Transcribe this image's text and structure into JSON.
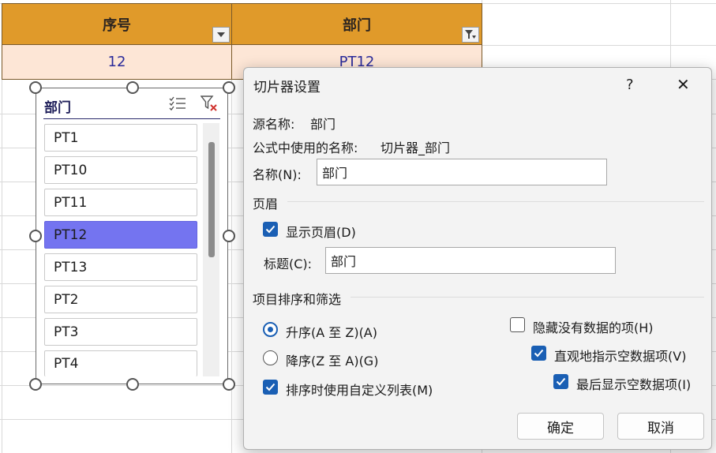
{
  "table": {
    "headers": [
      "序号",
      "部门"
    ],
    "row": [
      "12",
      "PT12"
    ]
  },
  "slicer": {
    "title": "部门",
    "items": [
      {
        "label": "PT1",
        "selected": false
      },
      {
        "label": "PT10",
        "selected": false
      },
      {
        "label": "PT11",
        "selected": false
      },
      {
        "label": "PT12",
        "selected": true
      },
      {
        "label": "PT13",
        "selected": false
      },
      {
        "label": "PT2",
        "selected": false
      },
      {
        "label": "PT3",
        "selected": false
      },
      {
        "label": "PT4",
        "selected": false
      }
    ],
    "icons": [
      "multi-select-icon",
      "clear-filter-icon"
    ]
  },
  "dialog": {
    "title": "切片器设置",
    "help": "?",
    "close": "✕",
    "source_label": "源名称:",
    "source_value": "部门",
    "formula_label": "公式中使用的名称:",
    "formula_value": "切片器_部门",
    "name_label": "名称(N):",
    "name_value": "部门",
    "header_section": "页眉",
    "show_header": "显示页眉(D)",
    "caption_label": "标题(C):",
    "caption_value": "部门",
    "sort_section": "项目排序和筛选",
    "ascending": "升序(A 至 Z)(A)",
    "descending": "降序(Z 至 A)(G)",
    "custom_list": "排序时使用自定义列表(M)",
    "hide_no_data": "隐藏没有数据的项(H)",
    "visual_indicate": "直观地指示空数据项(V)",
    "show_last": "最后显示空数据项(I)",
    "ok": "确定",
    "cancel": "取消"
  },
  "colors": {
    "header_fill": "#e09a2a",
    "row_fill": "#fde6d6",
    "selected_item": "#7474f0",
    "accent": "#1a5fb4"
  }
}
